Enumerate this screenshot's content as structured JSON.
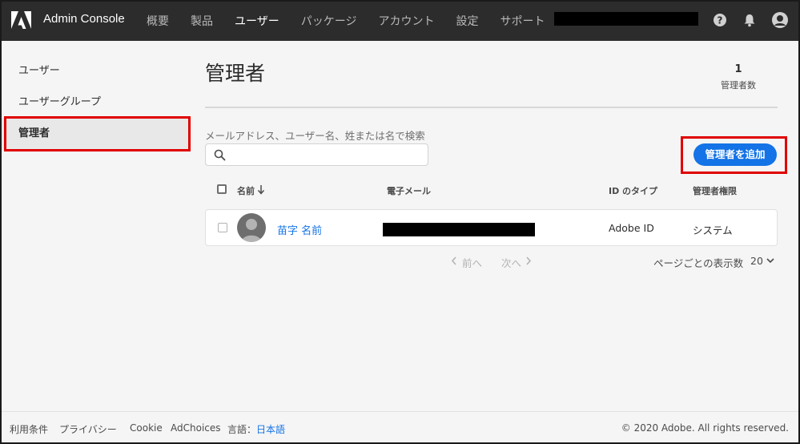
{
  "app": {
    "title": "Admin Console",
    "logo_icon": "adobe-logo-icon"
  },
  "nav": {
    "items": [
      {
        "label": "概要"
      },
      {
        "label": "製品"
      },
      {
        "label": "ユーザー",
        "active": true
      },
      {
        "label": "パッケージ"
      },
      {
        "label": "アカウント"
      },
      {
        "label": "設定"
      },
      {
        "label": "サポート"
      }
    ],
    "right_icons": [
      "help-icon",
      "bell-icon",
      "user-avatar-icon"
    ]
  },
  "sidebar": {
    "items": [
      {
        "label": "ユーザー"
      },
      {
        "label": "ユーザーグループ"
      },
      {
        "label": "管理者",
        "selected": true
      }
    ]
  },
  "main": {
    "title": "管理者",
    "count": {
      "value": "1",
      "label": "管理者数"
    },
    "search": {
      "label": "メールアドレス、ユーザー名、姓または名で検索",
      "value": "",
      "placeholder": ""
    },
    "add_button": "管理者を追加",
    "table": {
      "columns": {
        "name": "名前",
        "email": "電子メール",
        "id_type": "ID のタイプ",
        "role": "管理者権限"
      },
      "rows": [
        {
          "name": "苗字 名前",
          "id_type": "Adobe ID",
          "role": "システム"
        }
      ]
    },
    "pagination": {
      "prev": "前へ",
      "next": "次へ",
      "per_page_label": "ページごとの表示数",
      "per_page_value": "20"
    }
  },
  "footer": {
    "links": [
      "利用条件",
      "プライバシー",
      "Cookie",
      "AdChoices"
    ],
    "language_label": "言語：",
    "language_value": "日本語",
    "copyright": "© 2020 Adobe. All rights reserved."
  },
  "colors": {
    "topbar": "#2c2c2c",
    "accent": "#1473e6",
    "highlight": "#e00000",
    "background": "#f5f5f5"
  }
}
